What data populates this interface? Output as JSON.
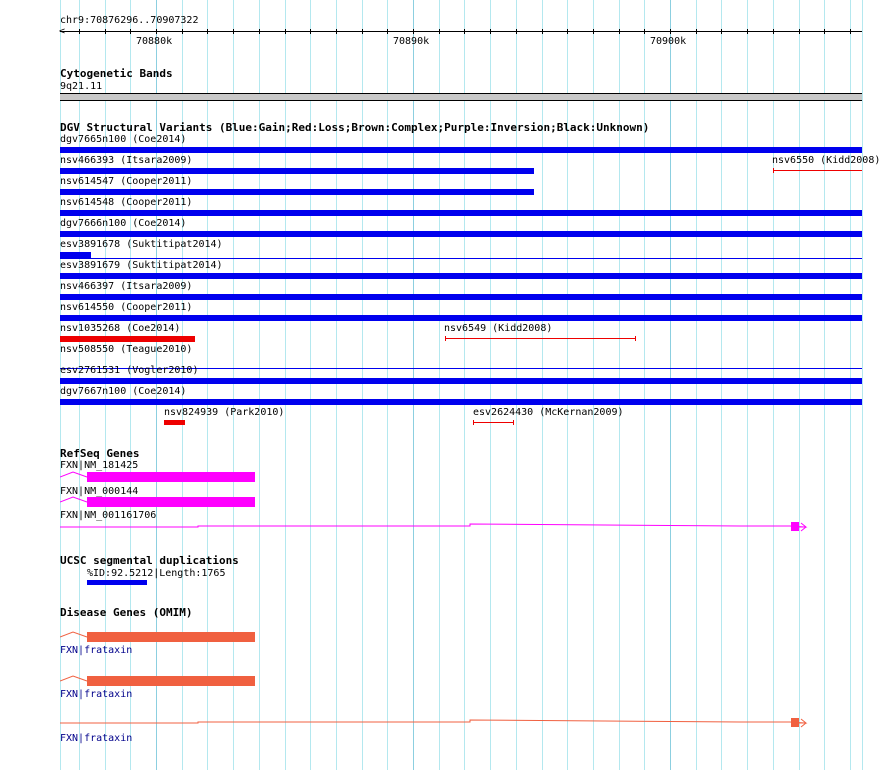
{
  "ruler": {
    "region": "chr9:70876296..70907322",
    "labels": [
      "70880k",
      "70890k",
      "70900k"
    ]
  },
  "cytobands": {
    "title": "Cytogenetic Bands",
    "band": "9q21.11"
  },
  "dgv": {
    "title": "DGV Structural Variants (Blue:Gain;Red:Loss;Brown:Complex;Purple:Inversion;Black:Unknown)",
    "rows": [
      "dgv7665n100 (Coe2014)",
      "nsv466393 (Itsara2009)",
      "nsv614547 (Cooper2011)",
      "nsv614548 (Cooper2011)",
      "dgv7666n100 (Coe2014)",
      "esv3891678 (Suktitipat2014)",
      "esv3891679 (Suktitipat2014)",
      "nsv466397 (Itsara2009)",
      "nsv614550 (Cooper2011)",
      "nsv1035268 (Coe2014)",
      "nsv508550 (Teague2010)",
      "esv2761531 (Vogler2010)",
      "dgv7667n100 (Coe2014)",
      "nsv824939 (Park2010)"
    ],
    "extra": [
      "nsv6550 (Kidd2008)",
      "nsv6549 (Kidd2008)",
      "esv2624430 (McKernan2009)"
    ]
  },
  "refseq": {
    "title": "RefSeq Genes",
    "genes": [
      "FXN|NM_181425",
      "FXN|NM_000144",
      "FXN|NM_001161706"
    ]
  },
  "segdup": {
    "title": "UCSC segmental duplications",
    "item": "%ID:92.5212|Length:1765"
  },
  "omim": {
    "title": "Disease Genes (OMIM)",
    "genes": [
      "FXN|frataxin",
      "FXN|frataxin",
      "FXN|frataxin"
    ]
  },
  "colors": {
    "gain": "#0000ee",
    "loss": "#ee0000",
    "refseq": "#ff00ff",
    "omim": "#f06040"
  }
}
